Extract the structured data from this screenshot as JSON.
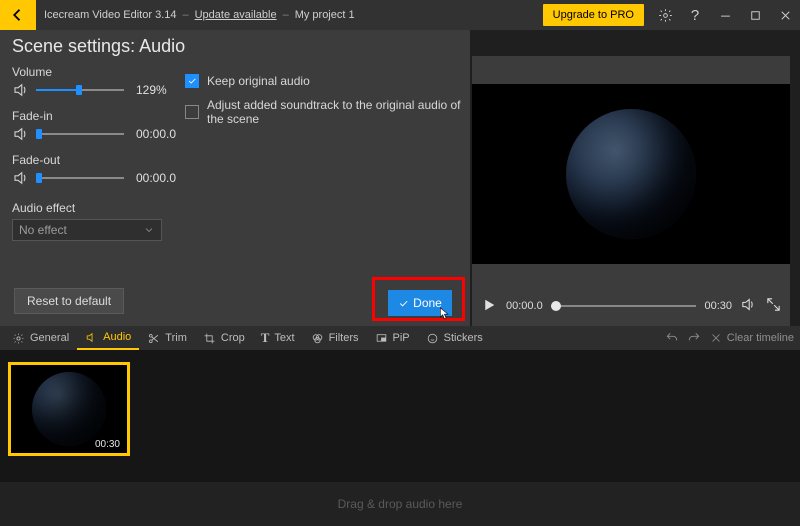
{
  "title": {
    "app": "Icecream Video Editor 3.14",
    "update": "Update available",
    "project": "My project 1"
  },
  "upgrade": "Upgrade to PRO",
  "heading": "Scene settings: Audio",
  "volume": {
    "label": "Volume",
    "value": "129%",
    "pct": 45
  },
  "fadein": {
    "label": "Fade-in",
    "value": "00:00.0",
    "pct": 0
  },
  "fadeout": {
    "label": "Fade-out",
    "value": "00:00.0",
    "pct": 0
  },
  "opts": {
    "keep": "Keep original audio",
    "adjust": "Adjust added soundtrack to the original audio of the scene"
  },
  "effect": {
    "label": "Audio effect",
    "value": "No effect"
  },
  "reset": "Reset to default",
  "done": "Done",
  "preview": {
    "cur": "00:00.0",
    "dur": "00:30"
  },
  "tabs": {
    "general": "General",
    "audio": "Audio",
    "trim": "Trim",
    "crop": "Crop",
    "text": "Text",
    "filters": "Filters",
    "pip": "PiP",
    "stickers": "Stickers"
  },
  "clear": "Clear timeline",
  "clip": {
    "dur": "00:30"
  },
  "drop": "Drag & drop audio here"
}
